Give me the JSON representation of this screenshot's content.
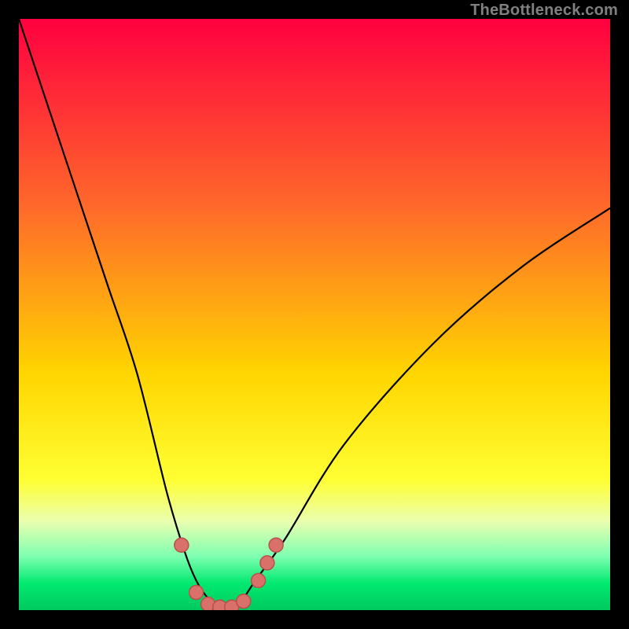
{
  "attribution": {
    "text": "TheBottleneck.com"
  },
  "chart_data": {
    "type": "line",
    "title": "",
    "xlabel": "",
    "ylabel": "",
    "xlim": [
      0,
      100
    ],
    "ylim": [
      0,
      100
    ],
    "grid": false,
    "legend": false,
    "gradient_stops": [
      {
        "pct": 0,
        "color": "#ff0040"
      },
      {
        "pct": 32,
        "color": "#ff6a2a"
      },
      {
        "pct": 60,
        "color": "#ffd500"
      },
      {
        "pct": 78,
        "color": "#ffff33"
      },
      {
        "pct": 85,
        "color": "#eaffb0"
      },
      {
        "pct": 91,
        "color": "#7cffb0"
      },
      {
        "pct": 95.5,
        "color": "#00e96f"
      },
      {
        "pct": 100,
        "color": "#00c95e"
      }
    ],
    "series": [
      {
        "name": "bottleneck-curve",
        "stroke": "#000000",
        "x": [
          0,
          5,
          10,
          15,
          20,
          25,
          28,
          30,
          32,
          34,
          35,
          36,
          37,
          38,
          40,
          45,
          55,
          70,
          85,
          100
        ],
        "values": [
          100,
          85,
          70,
          55,
          40,
          20,
          10,
          5,
          2,
          0.5,
          0,
          0.5,
          1,
          2,
          5,
          12,
          28,
          45,
          58,
          68
        ]
      }
    ],
    "markers": {
      "name": "highlight-dots",
      "color": "#d9706a",
      "stroke": "#b8514b",
      "radius_px": 9,
      "points": [
        {
          "x": 27.5,
          "y": 11
        },
        {
          "x": 30,
          "y": 3
        },
        {
          "x": 32,
          "y": 1
        },
        {
          "x": 34,
          "y": 0.5
        },
        {
          "x": 36,
          "y": 0.5
        },
        {
          "x": 38,
          "y": 1.5
        },
        {
          "x": 40.5,
          "y": 5
        },
        {
          "x": 42,
          "y": 8
        },
        {
          "x": 43.5,
          "y": 11
        }
      ]
    }
  }
}
